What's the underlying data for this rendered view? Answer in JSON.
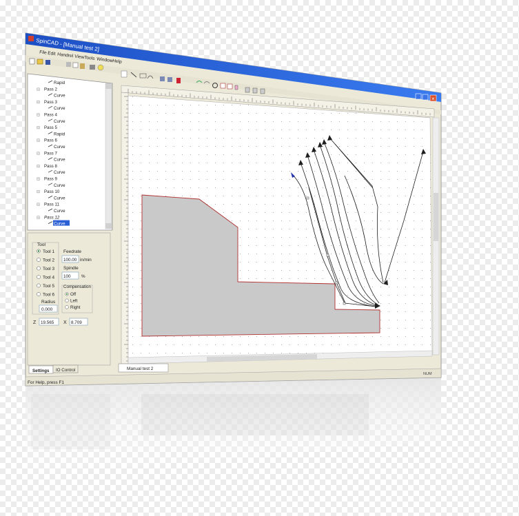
{
  "window": {
    "title": "SpinCAD - [Manual test 2]",
    "colors": {
      "titlebar": "#2a5fd6",
      "chrome": "#ece9d8",
      "canvas": "#ffffff",
      "part_fill": "#c8c8c8",
      "part_edge": "#b03030",
      "path_color": "#222222",
      "tool_start": "#2233aa"
    }
  },
  "menu": {
    "items": [
      "File",
      "Edit",
      "Handrel",
      "View",
      "Tools",
      "Window",
      "Help"
    ]
  },
  "tree": {
    "items": [
      {
        "label": "Rapid",
        "child": true
      },
      {
        "label": "Pass 2",
        "child": false
      },
      {
        "label": "Curve",
        "child": true
      },
      {
        "label": "Pass 3",
        "child": false
      },
      {
        "label": "Curve",
        "child": true
      },
      {
        "label": "Pass 4",
        "child": false
      },
      {
        "label": "Curve",
        "child": true
      },
      {
        "label": "Pass 5",
        "child": false
      },
      {
        "label": "Rapid",
        "child": true
      },
      {
        "label": "Pass 6",
        "child": false
      },
      {
        "label": "Curve",
        "child": true
      },
      {
        "label": "Pass 7",
        "child": false
      },
      {
        "label": "Curve",
        "child": true
      },
      {
        "label": "Pass 8",
        "child": false
      },
      {
        "label": "Curve",
        "child": true
      },
      {
        "label": "Pass 9",
        "child": false
      },
      {
        "label": "Curve",
        "child": true
      },
      {
        "label": "Pass 10",
        "child": false
      },
      {
        "label": "Curve",
        "child": true
      },
      {
        "label": "Pass 11",
        "child": false
      },
      {
        "label": "Curve",
        "child": true
      },
      {
        "label": "Pass 12",
        "child": false
      },
      {
        "label": "Curve",
        "child": true,
        "selected": true
      }
    ]
  },
  "tool_panel": {
    "group_label": "Tool",
    "tools": [
      "Tool 1",
      "Tool 2",
      "Tool 3",
      "Tool 4",
      "Tool 5",
      "Tool 6"
    ],
    "selected_tool": "Tool 1",
    "radius_label": "Radius",
    "radius_value": "0.000",
    "feedrate_label": "Feedrate",
    "feedrate_value": "100.00",
    "feedrate_unit": "in/min",
    "spindle_label": "Spindle",
    "spindle_value": "100",
    "spindle_unit": "%",
    "compensation_label": "Compensation",
    "compensation_options": [
      "Off",
      "Left",
      "Right"
    ],
    "compensation_selected": "Off",
    "z_label": "Z",
    "z_value": "19.565",
    "x_label": "X",
    "x_value": "8.709"
  },
  "bottom_tabs": [
    "Settings",
    "IO Control"
  ],
  "doc_tab": "Manual test 2",
  "status": {
    "left": "For Help, press F1",
    "right": "NUM"
  }
}
